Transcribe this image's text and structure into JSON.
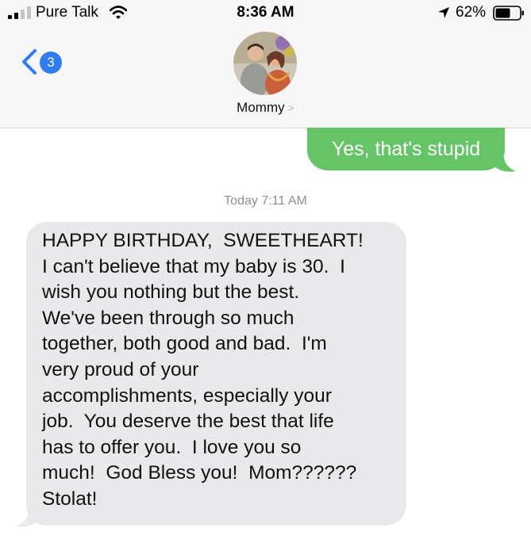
{
  "status_bar": {
    "carrier": "Pure Talk",
    "time": "8:36 AM",
    "battery_percent": "62%",
    "battery_level": 0.62,
    "signal_bars": 2
  },
  "nav": {
    "back_badge": "3",
    "contact_name": "Mommy",
    "contact_chevron": ">"
  },
  "messages": {
    "sent_text": "Yes, that's stupid",
    "timestamp": "Today 7:11 AM",
    "received_lines": [
      "HAPPY BIRTHDAY,  SWEETHEART!",
      "I can't believe that my baby is 30.  I",
      "wish you nothing but the best.",
      "We've been through so much",
      "together, both good and bad.  I'm",
      "very proud of your",
      "accomplishments, especially your",
      "job.  You deserve the best that life",
      "has to offer you.  I love you so",
      "much!  God Bless you!  Mom??????",
      "Stolat!"
    ]
  },
  "colors": {
    "accent_blue": "#2f7cf6",
    "sent_bubble": "#65c466",
    "received_bubble": "#e9e9eb",
    "header_bg": "#f6f6f6"
  },
  "icons": {
    "signal": "cellular-signal-icon",
    "wifi": "wifi-icon",
    "location": "location-arrow-icon",
    "battery": "battery-icon",
    "back": "chevron-left-icon"
  }
}
